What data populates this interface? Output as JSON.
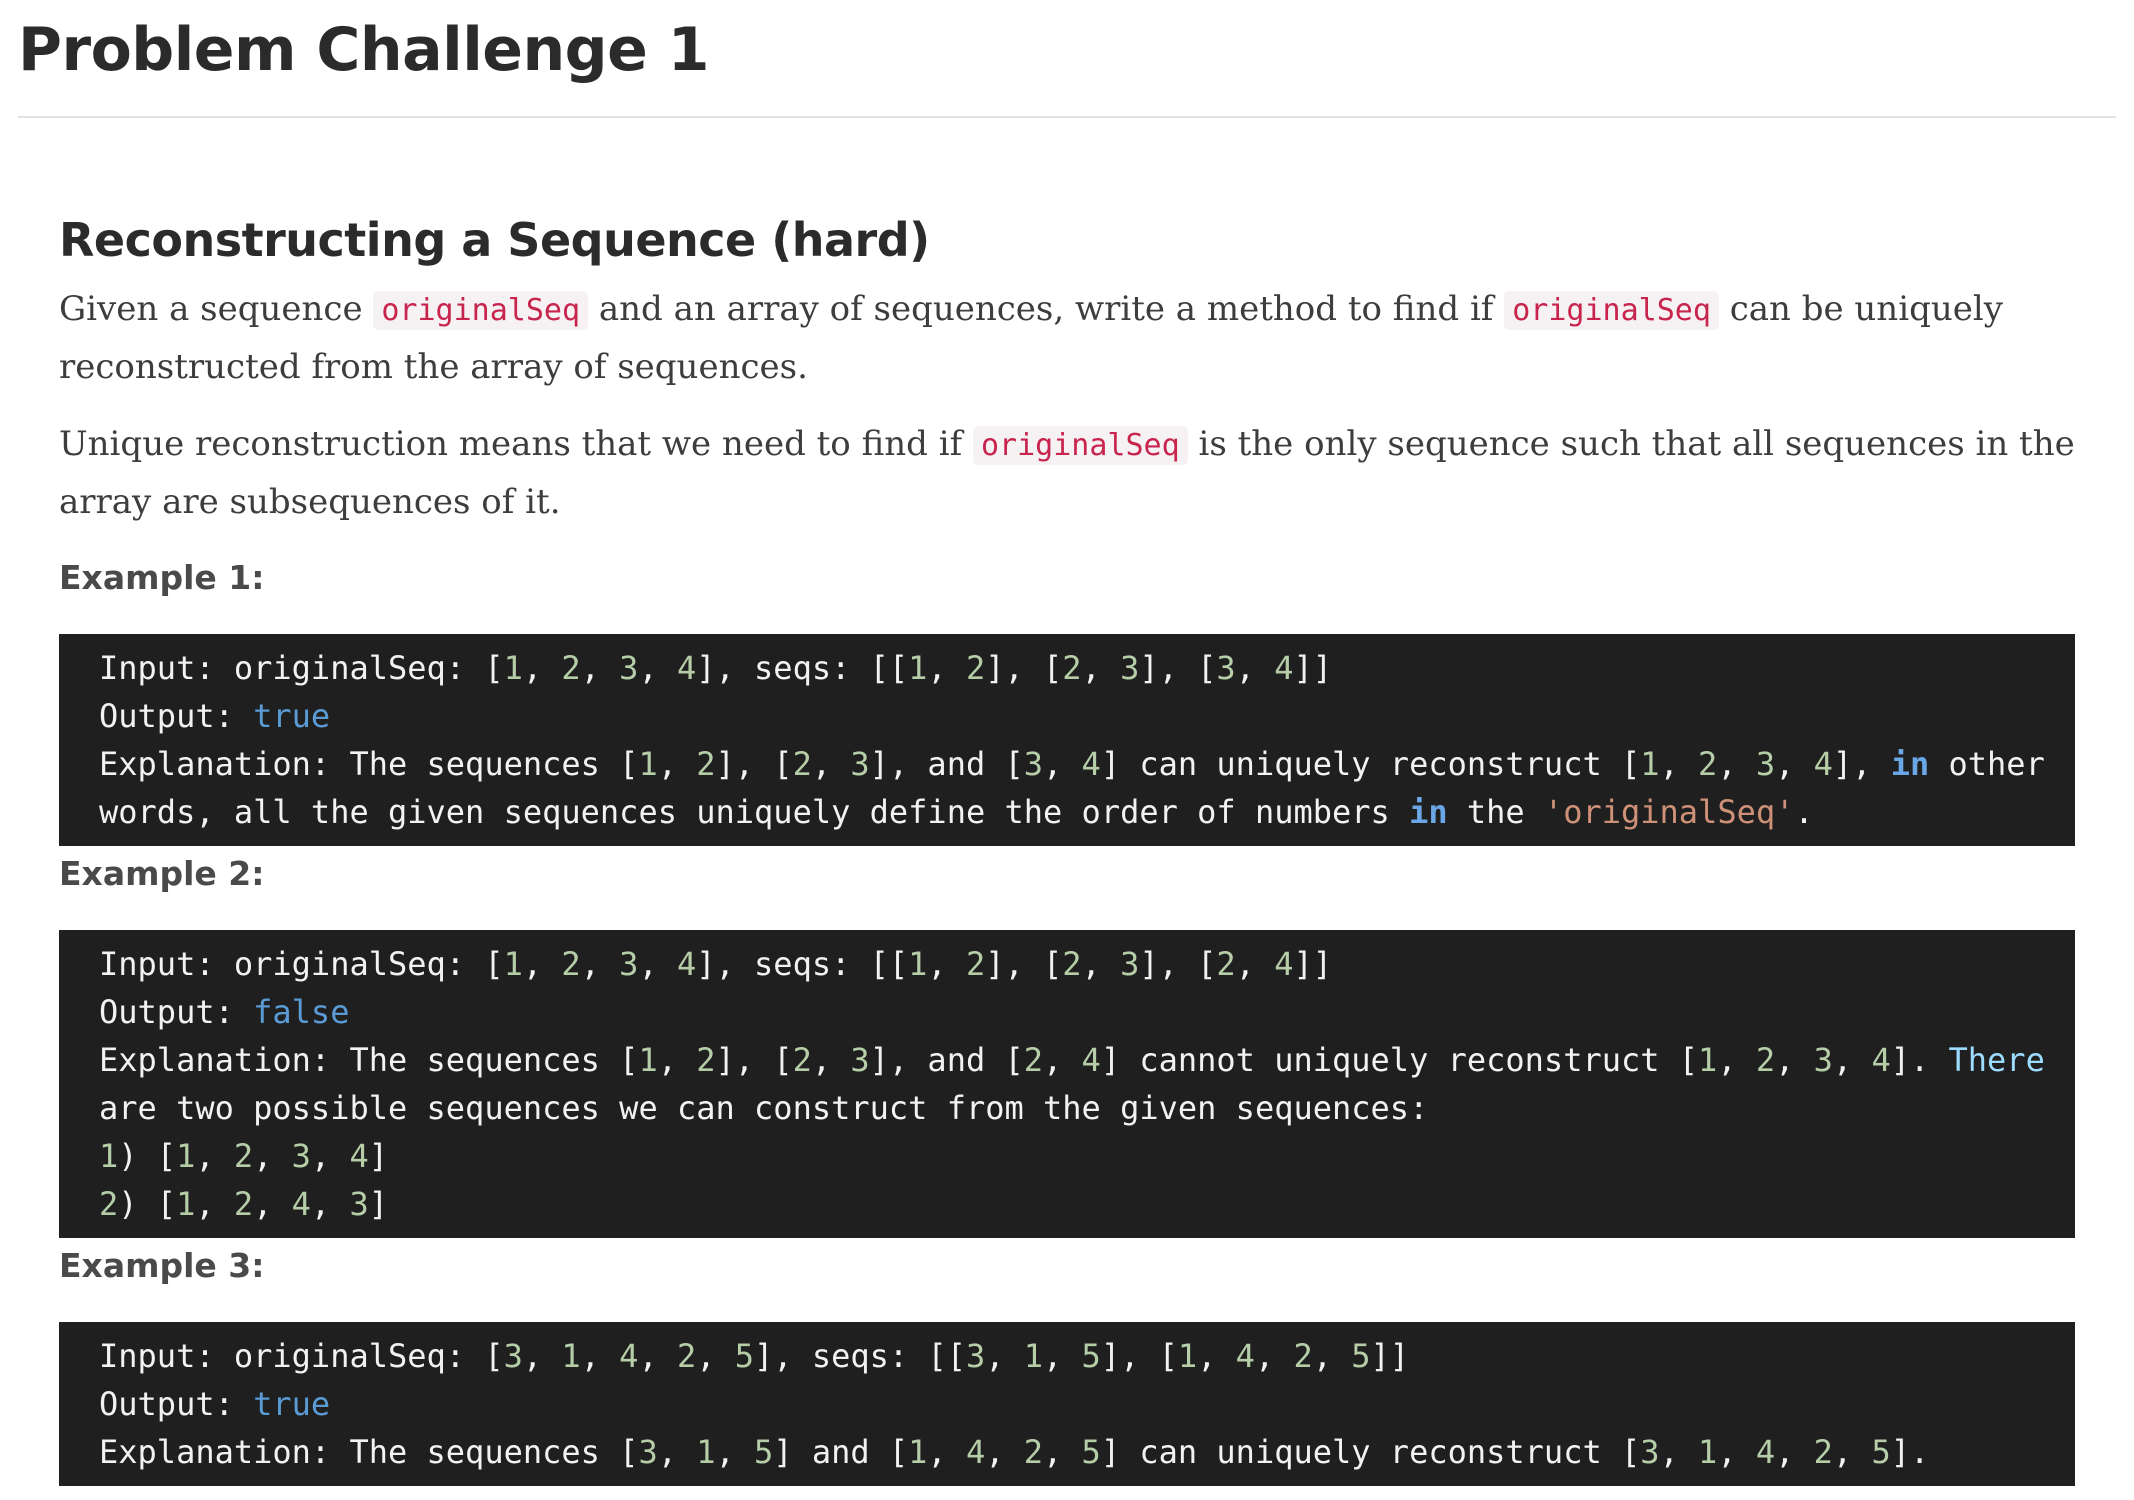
{
  "page_title": "Problem Challenge 1",
  "section_title": "Reconstructing a Sequence (hard)",
  "intro": {
    "p1_before": "Given a sequence ",
    "p1_code1": "originalSeq",
    "p1_middle": " and an array of sequences, write a method to find if ",
    "p1_code2": "originalSeq",
    "p1_after": " can be uniquely reconstructed from the array of sequences.",
    "p2_before": "Unique reconstruction means that we need to find if ",
    "p2_code": "originalSeq",
    "p2_after": " is the only sequence such that all sequences in the array are subsequences of it."
  },
  "examples": [
    {
      "label": "Example 1:",
      "lines": [
        "Input: originalSeq: [1, 2, 3, 4], seqs: [[1, 2], [2, 3], [3, 4]]",
        "Output: true",
        "Explanation: The sequences [1, 2], [2, 3], and [3, 4] can uniquely reconstruct [1, 2, 3, 4], in other",
        "words, all the given sequences uniquely define the order of numbers in the 'originalSeq'."
      ]
    },
    {
      "label": "Example 2:",
      "lines": [
        "Input: originalSeq: [1, 2, 3, 4], seqs: [[1, 2], [2, 3], [2, 4]]",
        "Output: false",
        "Explanation: The sequences [1, 2], [2, 3], and [2, 4] cannot uniquely reconstruct [1, 2, 3, 4]. There",
        "are two possible sequences we can construct from the given sequences:",
        "1) [1, 2, 3, 4]",
        "2) [1, 2, 4, 3]"
      ]
    },
    {
      "label": "Example 3:",
      "lines": [
        "Input: originalSeq: [3, 1, 4, 2, 5], seqs: [[3, 1, 5], [1, 4, 2, 5]]",
        "Output: true",
        "Explanation: The sequences [3, 1, 5] and [1, 4, 2, 5] can uniquely reconstruct [3, 1, 4, 2, 5]."
      ]
    }
  ]
}
